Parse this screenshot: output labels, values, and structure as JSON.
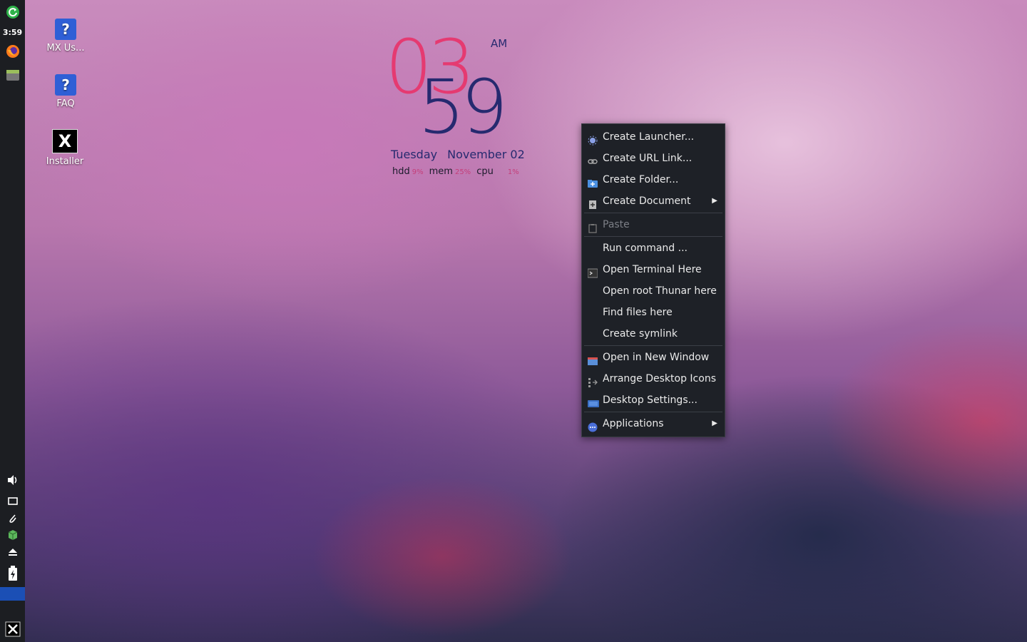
{
  "panel": {
    "time": "3:59",
    "icons": [
      "update-icon",
      "firefox-icon",
      "file-manager-icon",
      "volume-icon",
      "display-icon",
      "clipboard-icon",
      "package-icon",
      "eject-icon",
      "battery-icon",
      "mx-menu-icon"
    ]
  },
  "desktop": {
    "icons": [
      {
        "label": "MX Us..."
      },
      {
        "label": "FAQ"
      },
      {
        "label": "Installer"
      }
    ],
    "help_glyph": "?",
    "installer_glyph": "X"
  },
  "conky": {
    "hour": "03",
    "minute": "59",
    "ampm": "AM",
    "weekday": "Tuesday",
    "date": "November 02",
    "hdd_label": "hdd",
    "hdd_value": "9%",
    "mem_label": "mem",
    "mem_value": "25%",
    "cpu_label": "cpu",
    "cpu_value": "1%"
  },
  "menu": {
    "create_launcher": "Create Launcher...",
    "create_url_link": "Create URL Link...",
    "create_folder": "Create Folder...",
    "create_document": "Create Document",
    "paste": "Paste",
    "run_command": "Run command ...",
    "open_terminal": "Open Terminal Here",
    "open_root_thunar": "Open root Thunar here",
    "find_files": "Find files here",
    "create_symlink": "Create symlink",
    "open_new_window": "Open in New Window",
    "arrange_icons": "Arrange Desktop Icons",
    "desktop_settings": "Desktop Settings...",
    "applications": "Applications",
    "submenu_arrow": "▶"
  },
  "colors": {
    "hour": "#e53a71",
    "minute": "#262a6f",
    "menu_bg": "#1e2127",
    "panel_bg": "#1c1e22",
    "accent": "#1b4fb5"
  }
}
